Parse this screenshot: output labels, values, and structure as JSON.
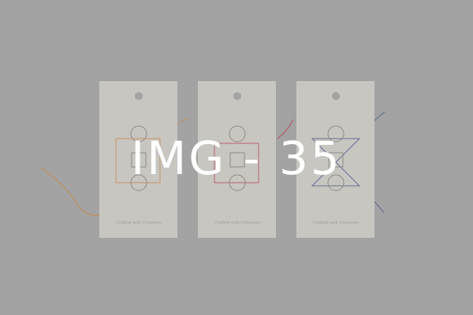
{
  "overlay": {
    "title": "IMG - 35"
  },
  "tags": [
    {
      "caption": "Crafted with Creations",
      "accent": "#c48a4a"
    },
    {
      "caption": "Crafted with Creations",
      "accent": "#b7475a"
    },
    {
      "caption": "Crafted with Creations",
      "accent": "#4b5a86"
    }
  ],
  "colors": {
    "background": "#a3a3a3",
    "tag_paper": "#c8c6c1",
    "overlay_text": "#ffffff"
  }
}
